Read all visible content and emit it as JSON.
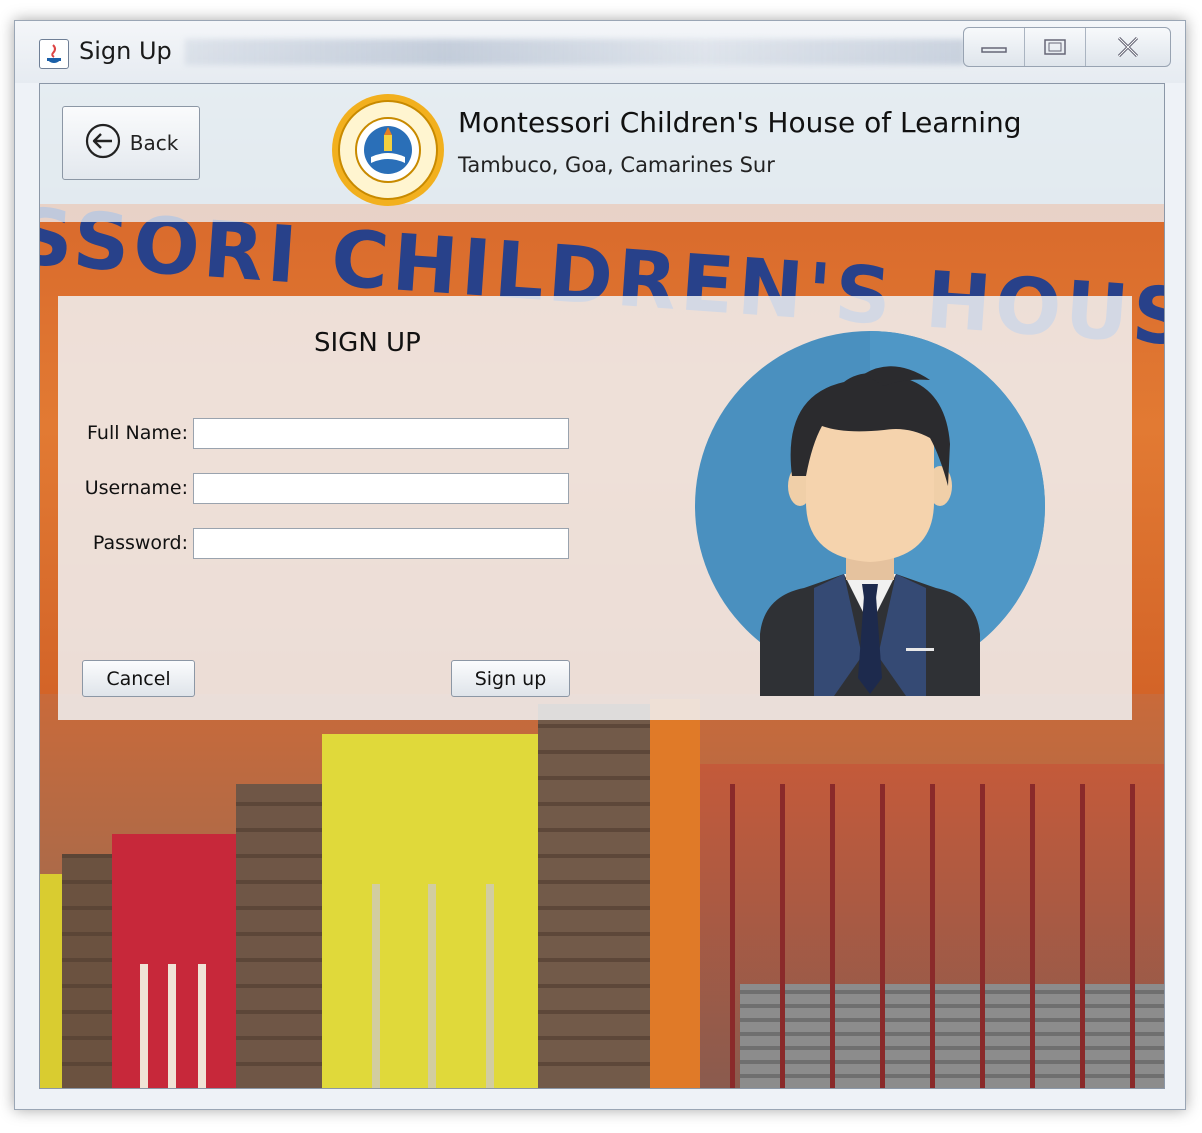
{
  "window": {
    "title": "Sign Up",
    "controls": {
      "minimize": "minimize-icon",
      "maximize": "maximize-icon",
      "close": "close-icon"
    }
  },
  "header": {
    "back_label": "Back",
    "school_name": "Montessori Children's House of Learning",
    "school_address": "Tambuco, Goa, Camarines Sur"
  },
  "background": {
    "banner_text": "SSORI CHILDREN'S HOUSE OF LEARNING"
  },
  "form": {
    "title": "SIGN UP",
    "full_name_label": "Full Name:",
    "full_name_value": "",
    "username_label": "Username:",
    "username_value": "",
    "password_label": "Password:",
    "password_value": "",
    "cancel_label": "Cancel",
    "signup_label": "Sign up"
  },
  "colors": {
    "avatar_bg": "#4a90bf",
    "banner_text": "#1f3f8f",
    "building": "#e27a33"
  }
}
